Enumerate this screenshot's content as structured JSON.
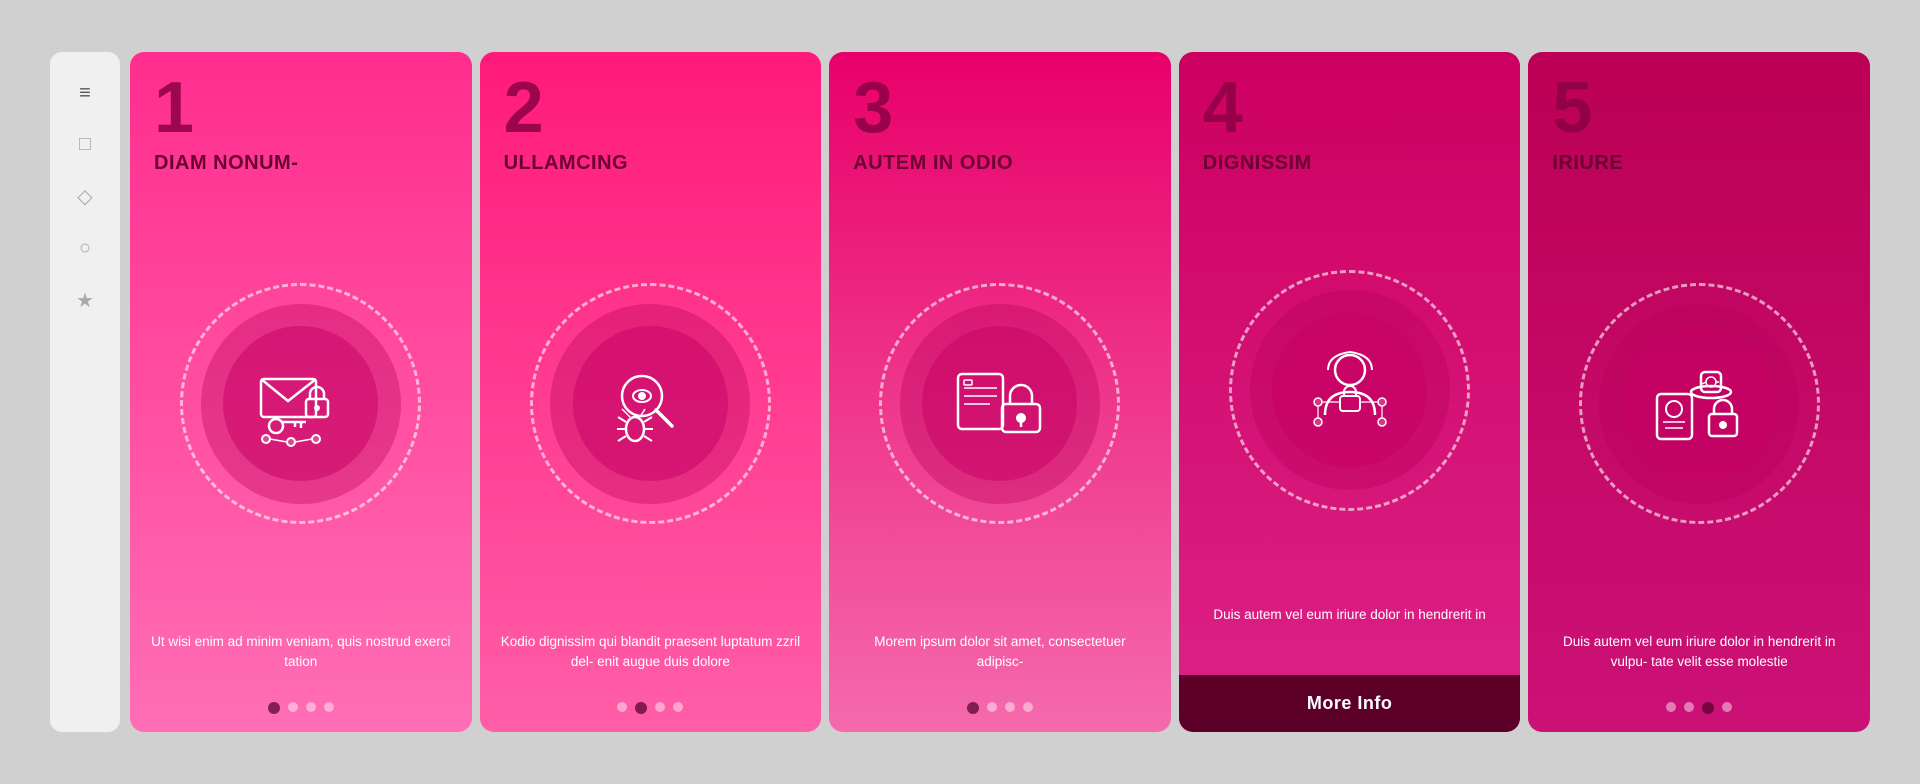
{
  "sidebar": {
    "icons": [
      {
        "name": "menu-icon",
        "symbol": "≡"
      },
      {
        "name": "square-icon",
        "symbol": "□"
      },
      {
        "name": "diamond-icon",
        "symbol": "◇"
      },
      {
        "name": "circle-icon",
        "symbol": "○"
      },
      {
        "name": "star-icon",
        "symbol": "★"
      }
    ]
  },
  "cards": [
    {
      "id": 1,
      "number": "1",
      "title": "DIAM NONUM-",
      "description": "Ut wisi enim ad minim veniam, quis nostrud exerci tation",
      "dots": [
        true,
        false,
        false,
        false
      ],
      "active_dot": 0,
      "icon_type": "email-lock"
    },
    {
      "id": 2,
      "number": "2",
      "title": "ULLAMCING",
      "description": "Kodio dignissim qui blandit praesent luptatum zzril del- enit augue duis dolore",
      "dots": [
        false,
        true,
        false,
        false
      ],
      "active_dot": 1,
      "icon_type": "bug-search"
    },
    {
      "id": 3,
      "number": "3",
      "title": "AUTEM IN ODIO",
      "description": "Morem ipsum dolor sit amet, consectetuer adipisc-",
      "dots": [
        true,
        false,
        false,
        false
      ],
      "active_dot": 0,
      "icon_type": "data-lock"
    },
    {
      "id": 4,
      "number": "4",
      "title": "DIGNISSIM",
      "description": "Duis autem vel eum iriure dolor in hendrerit in",
      "has_button": true,
      "button_label": "More Info",
      "dots": null,
      "icon_type": "hacker"
    },
    {
      "id": 5,
      "number": "5",
      "title": "IRIURE",
      "description": "Duis autem vel eum iriure dolor in hendrerit in vulpu- tate velit esse molestie",
      "dots": [
        false,
        false,
        true,
        false
      ],
      "active_dot": 2,
      "icon_type": "spy"
    }
  ]
}
